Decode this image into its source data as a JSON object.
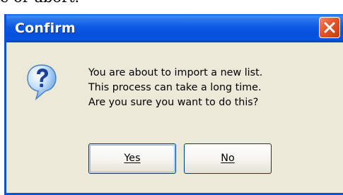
{
  "background_caption": "e or abort.",
  "dialog": {
    "title": "Confirm",
    "close_icon": "close-icon",
    "icon": "question-icon",
    "message_lines": [
      "You are about to import a new list.",
      "This process can take a long time.",
      "Are you sure you want to do this?"
    ],
    "buttons": {
      "yes_label": "Yes",
      "no_label": "No"
    }
  },
  "colors": {
    "titlebar": "#0551dd",
    "close_button": "#e4552b",
    "dialog_body": "#ece9d8",
    "button_border": "#003c74"
  }
}
